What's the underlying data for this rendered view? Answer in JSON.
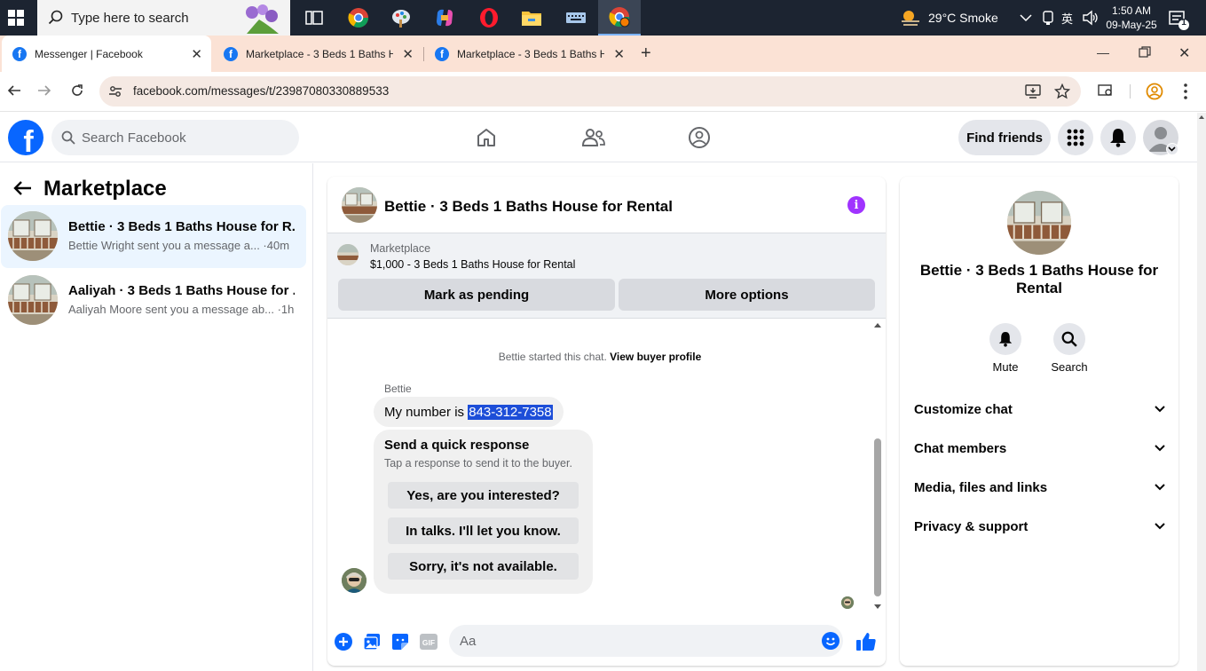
{
  "taskbar": {
    "search_placeholder": "Type here to search",
    "weather": "29°C  Smoke",
    "time": "1:50 AM",
    "date": "09-May-25",
    "notification_count": "1"
  },
  "browser": {
    "tabs": [
      {
        "title": "Messenger | Facebook",
        "active": true
      },
      {
        "title": "Marketplace - 3 Beds 1 Baths H",
        "active": false
      },
      {
        "title": "Marketplace - 3 Beds 1 Baths H",
        "active": false
      }
    ],
    "url": "facebook.com/messages/t/23987080330889533"
  },
  "fb_header": {
    "search_placeholder": "Search Facebook",
    "find_friends": "Find friends"
  },
  "left_panel": {
    "title": "Marketplace",
    "conversations": [
      {
        "name": "Bettie · 3 Beds 1 Baths House for R...",
        "preview": "Bettie Wright sent you a message a... ·40m",
        "selected": true
      },
      {
        "name": "Aaliyah · 3 Beds 1 Baths House for ...",
        "preview": "Aaliyah Moore sent you a message ab... ·1h",
        "selected": false
      }
    ]
  },
  "chat": {
    "title": "Bettie · 3 Beds 1 Baths House for Rental",
    "listing_label": "Marketplace",
    "listing_title": "$1,000 - 3 Beds 1 Baths House for Rental",
    "mark_pending": "Mark as pending",
    "more_options": "More options",
    "started_text": "Bettie started this chat.",
    "view_profile": "View buyer profile",
    "sender": "Bettie",
    "message_prefix": "My number is ",
    "message_phone": "843-312-7358",
    "quick_title": "Send a quick response",
    "quick_sub": "Tap a response to send it to the buyer.",
    "quick_responses": [
      "Yes, are you interested?",
      "In talks. I'll let you know.",
      "Sorry, it's not available."
    ],
    "composer_placeholder": "Aa"
  },
  "right_panel": {
    "name": "Bettie · 3 Beds 1 Baths House for Rental",
    "mute": "Mute",
    "search": "Search",
    "sections": [
      "Customize chat",
      "Chat members",
      "Media, files and links",
      "Privacy & support"
    ]
  },
  "colors": {
    "facebook_blue": "#0866ff",
    "selected_bg": "#ebf5ff",
    "info_purple": "#a033ff",
    "tabstrip": "#fbe2d5"
  }
}
